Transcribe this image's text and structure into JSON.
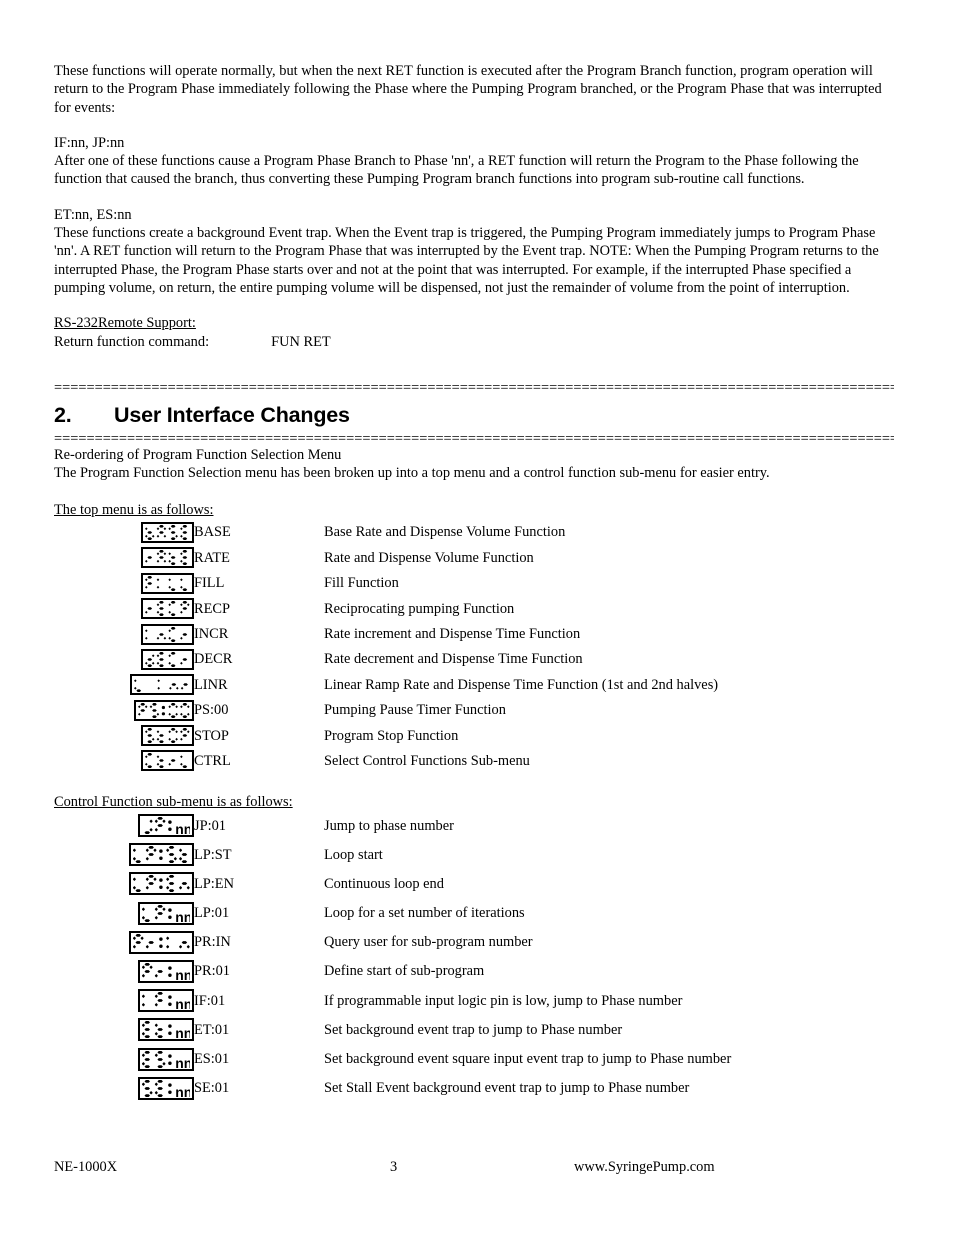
{
  "document": {
    "intro_paragraph": "These functions will operate normally, but when the next RET function is executed after the Program Branch function, program operation will return to the Program Phase immediately following the Phase where the Pumping Program branched, or the Program Phase that was interrupted for events:",
    "block_if_jp_title": "IF:nn, JP:nn",
    "block_if_jp_body": "After one of these functions cause a Program Phase Branch to Phase 'nn', a RET function will return the Program to the Phase following the function that caused the branch, thus converting these Pumping Program branch functions into program sub-routine call functions.",
    "block_et_es_title": "ET:nn, ES:nn",
    "block_et_es_body": "These functions create a background Event trap.  When the Event trap is triggered, the Pumping Program immediately jumps to Program Phase 'nn'.  A RET function will return to the Program Phase that was interrupted by the Event trap.  NOTE:  When the Pumping Program returns to the interrupted Phase, the Program Phase starts over and not at the point that was interrupted.  For example, if the interrupted Phase specified a pumping volume, on return, the entire pumping volume will be dispensed, not just the remainder of volume from the point of interruption.",
    "rs232_heading": "RS-232Remote Support:",
    "rs232_label": "Return function command:",
    "rs232_value": "FUN RET",
    "separator": "=========================================================================================================",
    "section_number": "2.",
    "section_title": "User Interface Changes",
    "subsection_title": "Re-ordering of Program Function Selection Menu",
    "subsection_body": "The Program Function Selection menu has been broken up into a top menu and a control function sub-menu for easier entry.",
    "top_menu_heading": "The top menu is as follows:",
    "sub_menu_heading": "Control Function sub-menu is as follows:"
  },
  "top_menu": {
    "items": [
      {
        "lcd": "bASE",
        "code": "BASE",
        "desc": "Base Rate and Dispense Volume Function"
      },
      {
        "lcd": "rAtE",
        "code": "RATE",
        "desc": "Rate and Dispense Volume Function"
      },
      {
        "lcd": "FILL",
        "code": "FILL",
        "desc": "Fill Function"
      },
      {
        "lcd": "rECP",
        "code": "RECP",
        "desc": "Reciprocating pumping Function"
      },
      {
        "lcd": "InCr",
        "code": "INCR",
        "desc": "Rate increment and Dispense Time Function"
      },
      {
        "lcd": "dECr",
        "code": "DECR",
        "desc": "Rate decrement and Dispense Time Function"
      },
      {
        "lcd": "L Inr",
        "code": "LINR",
        "desc": "Linear Ramp Rate and Dispense Time Function (1st and 2nd halves)"
      },
      {
        "lcd": "PS:00",
        "code": "PS:00",
        "desc": "Pumping Pause Timer Function"
      },
      {
        "lcd": "StOP",
        "code": "STOP",
        "desc": "Program Stop Function"
      },
      {
        "lcd": "CtrL",
        "code": "CTRL",
        "desc": "Select Control Functions Sub-menu"
      }
    ]
  },
  "sub_menu": {
    "items": [
      {
        "lcd": "JP:nn",
        "code": "JP:01",
        "desc": "Jump to phase number"
      },
      {
        "lcd": "LP:St",
        "code": "LP:ST",
        "desc": "Loop start"
      },
      {
        "lcd": "LP:En",
        "code": "LP:EN",
        "desc": "Continuous loop end"
      },
      {
        "lcd": "LP:nn",
        "code": "LP:01",
        "desc": "Loop for a set number of iterations"
      },
      {
        "lcd": "Pr:In",
        "code": "PR:IN",
        "desc": "Query user for sub-program number"
      },
      {
        "lcd": "Pr:nn",
        "code": "PR:01",
        "desc": "Define start of sub-program"
      },
      {
        "lcd": "IF:nn",
        "code": "IF:01",
        "desc": "If programmable input logic pin is low, jump to Phase number"
      },
      {
        "lcd": "Et:nn",
        "code": "ET:01",
        "desc": "Set background event trap to jump to Phase number"
      },
      {
        "lcd": "ES:nn",
        "code": "ES:01",
        "desc": "Set background event square input event trap to jump to Phase number"
      },
      {
        "lcd": "SE:nn",
        "code": "SE:01",
        "desc": "Set Stall Event background event trap to jump to Phase number"
      }
    ]
  },
  "footer": {
    "model": "NE-1000X",
    "page_number": "3",
    "website": "www.SyringePump.com"
  }
}
